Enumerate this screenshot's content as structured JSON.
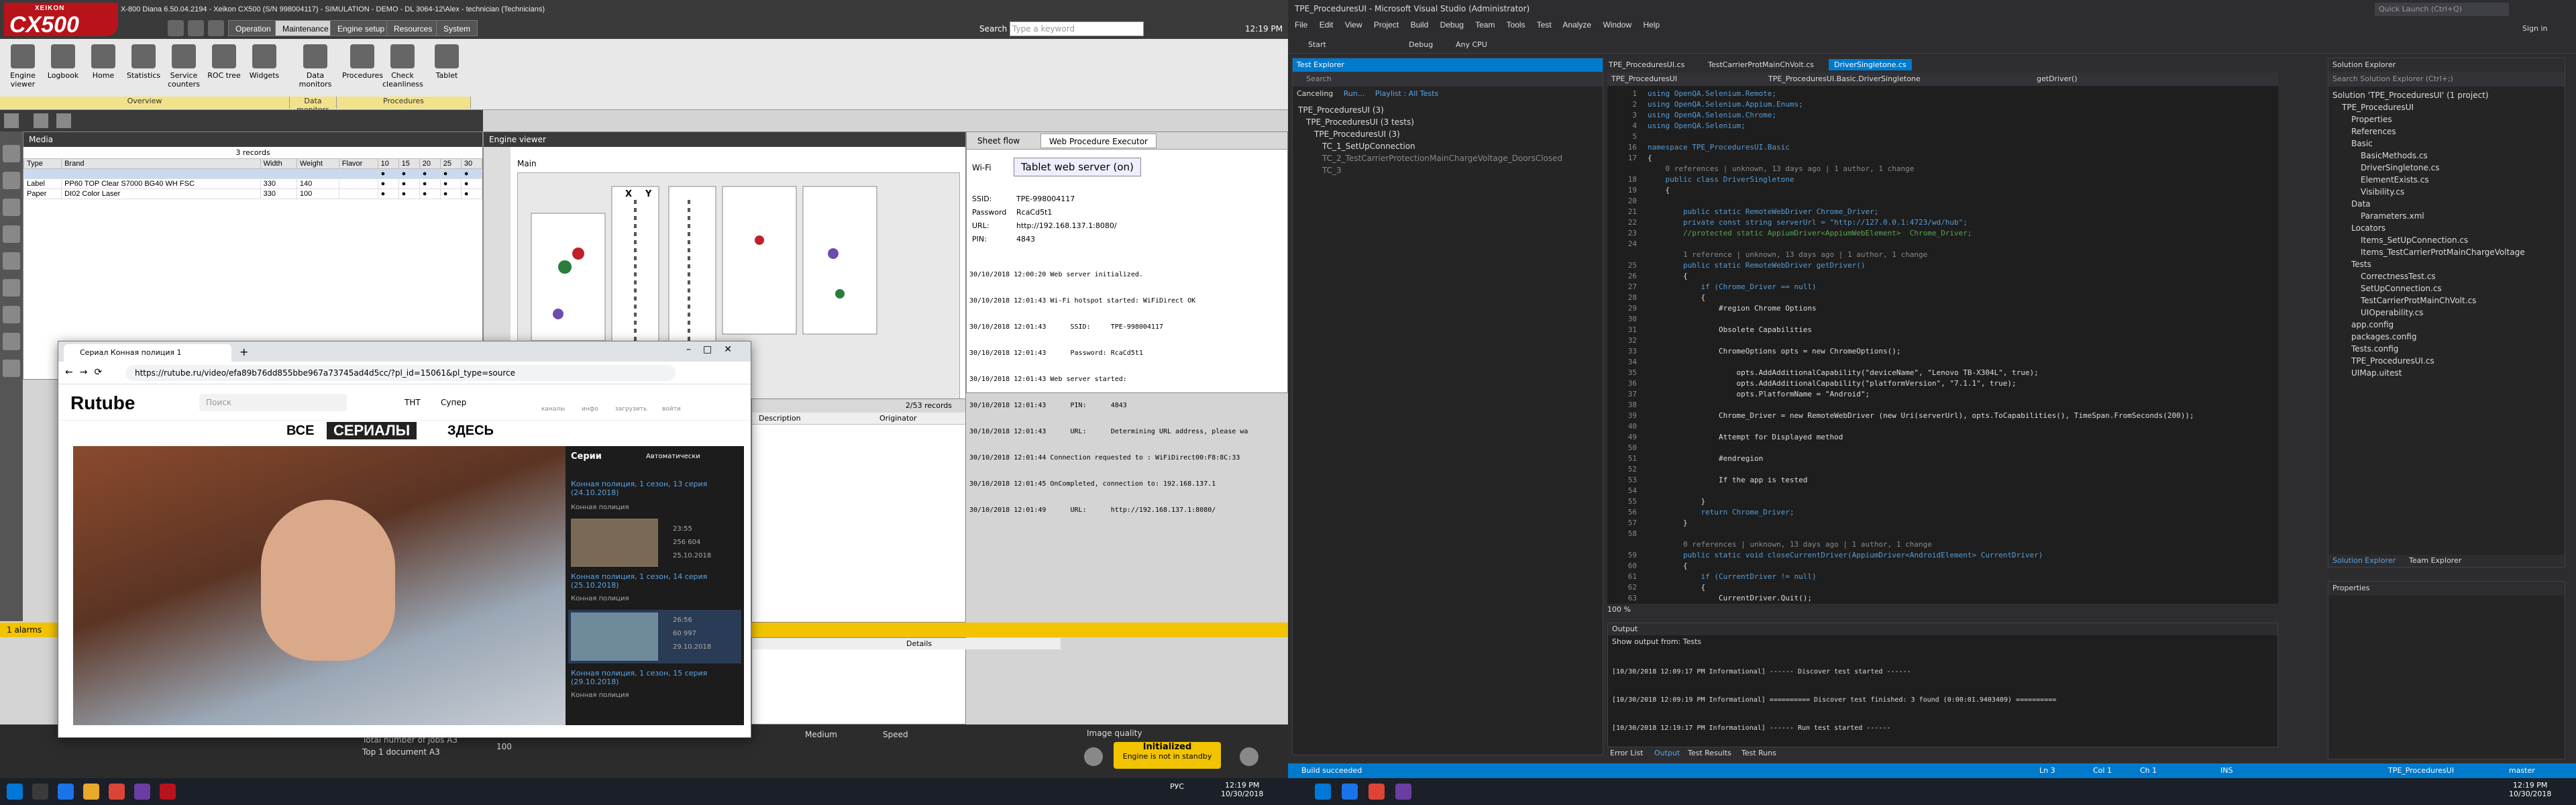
{
  "left_app": {
    "logo_small": "XEIKON",
    "logo_big": "CX500",
    "title": "X-800 Diana 6.50.04.2194 - Xeikon CX500 (S/N 998004117) - SIMULATION - DEMO - DL 3064-12\\Alex - technician (Technicians)",
    "nav_tabs": [
      "Operation",
      "Maintenance",
      "Engine setup",
      "Resources",
      "System"
    ],
    "search_label": "Search",
    "search_placeholder": "Type a keyword",
    "clock": "12:19 PM",
    "ribbon_buttons": [
      "Engine viewer",
      "Logbook",
      "Home",
      "Statistics",
      "Service counters",
      "ROC tree",
      "Widgets",
      "Data monitors",
      "Procedures",
      "Check cleanliness",
      "Tablet"
    ],
    "ribbon_groups": [
      "Overview",
      "Data monitors",
      "Procedures"
    ],
    "media_title": "Media",
    "media_records": "3 records",
    "media_columns": [
      "Type",
      "Brand",
      "Width",
      "Weight",
      "Flavor",
      "10",
      "15",
      "20",
      "25",
      "30"
    ],
    "media_rows": [
      [
        "Label",
        "PP60 TOP Clear S7000 BG40 WH FSC",
        "330",
        "140"
      ],
      [
        "Paper",
        "DI02 Color Laser",
        "330",
        "100"
      ]
    ],
    "engine_viewer_tab": "Engine viewer",
    "engine_main_label": "Main",
    "engine_xy": [
      "X",
      "Y"
    ],
    "sheet_flow_tab": "Sheet flow",
    "webproc_tab": "Web Procedure Executor",
    "wifi_label": "Wi-Fi",
    "wifi_button": "Tablet web server (on)",
    "ssid_label": "SSID:",
    "ssid_value": "TPE-998004117",
    "password_label": "Password",
    "password_value": "RcaCd5t1",
    "url_label": "URL:",
    "url_value": "http://192.168.137.1:8080/",
    "pin_label": "PIN:",
    "pin_value": "4843",
    "log_lines": [
      "30/10/2018 12:00:20 Web server initialized.",
      "30/10/2018 12:01:43 Wi-Fi hotspot started: WiFiDirect OK",
      "30/10/2018 12:01:43      SSID:     TPE-998004117",
      "30/10/2018 12:01:43      Password: RcaCd5t1",
      "30/10/2018 12:01:43 Web server started:",
      "30/10/2018 12:01:43      PIN:      4843",
      "30/10/2018 12:01:43      URL:      Determining URL address, please wa",
      "30/10/2018 12:01:44 Connection requested to : WiFiDirect00:F8:8C:33",
      "30/10/2018 12:01:45 OnCompleted, connection to: 192.168.137.1",
      "30/10/2018 12:01:49      URL:      http://192.168.137.1:8080/"
    ],
    "records_label": "2/53 records",
    "grid_cols": [
      "Description",
      "Originator"
    ],
    "alarm_text": "1 alarms",
    "details_label": "Details",
    "status_total": "Total number of jobs  A3",
    "status_top": "Top 1 document   A3",
    "status_speed": "100",
    "medium_label": "Medium",
    "speed_label": "Speed",
    "image_quality_label": "Image quality",
    "init_title": "Initialized",
    "init_sub": "Engine is not in standby"
  },
  "browser": {
    "tab_title": "Сериал Конная полиция 1",
    "url": "https://rutube.ru/video/efa89b76dd855bbe967a73745ad4d5cc/?pl_id=15061&pl_type=source",
    "brand": "Rutube",
    "search_placeholder": "Поиск",
    "nav_links": [
      "ТНТ",
      "Супер"
    ],
    "header_icons": [
      "каналы",
      "инфо",
      "загрузить",
      "войти"
    ],
    "banner_left": "ВСЕ",
    "banner_mid": "СЕРИАЛЫ",
    "banner_right": "ЗДЕСЬ",
    "sidebar_title": "Серии",
    "autoplay": "Автоматически",
    "episodes": [
      {
        "title": "Конная полиция, 1 сезон, 13 серия (24.10.2018)",
        "channel": "Конная полиция",
        "duration": "",
        "views": "",
        "date": ""
      },
      {
        "title": "Конная полиция, 1 сезон, 14 серия (25.10.2018)",
        "channel": "Конная полиция",
        "duration": "23:55",
        "views": "256 604",
        "date": "25.10.2018"
      },
      {
        "title": "Конная полиция, 1 сезон, 15 серия (29.10.2018)",
        "channel": "Конная полиция",
        "duration": "26:56",
        "views": "60 997",
        "date": "29.10.2018"
      }
    ]
  },
  "vs": {
    "title": "TPE_ProceduresUI - Microsoft Visual Studio (Administrator)",
    "quick_launch": "Quick Launch (Ctrl+Q)",
    "sign_in": "Sign in",
    "menu": [
      "File",
      "Edit",
      "View",
      "Project",
      "Build",
      "Debug",
      "Team",
      "Tools",
      "Test",
      "Analyze",
      "Window",
      "Help"
    ],
    "toolbar": [
      "Start",
      "Debug",
      "Any CPU"
    ],
    "test_explorer_title": "Test Explorer",
    "test_search": "Search",
    "test_bar": [
      "Canceling",
      "Run...",
      "Playlist : All Tests"
    ],
    "tests": [
      "TPE_ProceduresUI (3)",
      "TPE_ProceduresUI (3 tests)",
      "TPE_ProceduresUI (3)",
      "TC_1_SetUpConnection",
      "TC_2_TestCarrierProtectionMainChargeVoltage_DoorsClosed",
      "TC_3"
    ],
    "doc_tabs": [
      "TPE_ProceduresUI.cs",
      "TestCarrierProtMainChVolt.cs",
      "DriverSingletone.cs"
    ],
    "nav_left": "TPE_ProceduresUI",
    "nav_mid": "TPE_ProceduresUI.Basic.DriverSingletone",
    "nav_right": "getDriver()",
    "code_lines": [
      {
        "n": "1",
        "t": "using OpenQA.Selenium.Remote;"
      },
      {
        "n": "2",
        "t": "using OpenQA.Selenium.Appium.Enums;"
      },
      {
        "n": "3",
        "t": "using OpenQA.Selenium.Chrome;"
      },
      {
        "n": "4",
        "t": "using OpenQA.Selenium;"
      },
      {
        "n": "5",
        "t": ""
      },
      {
        "n": "16",
        "t": "namespace TPE_ProceduresUI.Basic"
      },
      {
        "n": "17",
        "t": "{"
      },
      {
        "n": "",
        "t": "    0 references | unknown, 13 days ago | 1 author, 1 change"
      },
      {
        "n": "18",
        "t": "    public class DriverSingletone"
      },
      {
        "n": "19",
        "t": "    {"
      },
      {
        "n": "20",
        "t": ""
      },
      {
        "n": "21",
        "t": "        public static RemoteWebDriver Chrome_Driver;"
      },
      {
        "n": "22",
        "t": "        private const string serverUrl = \"http://127.0.0.1:4723/wd/hub\";"
      },
      {
        "n": "23",
        "t": "        //protected static AppiumDriver<AppiumWebElement>  Chrome_Driver;"
      },
      {
        "n": "24",
        "t": ""
      },
      {
        "n": "",
        "t": "        1 reference | unknown, 13 days ago | 1 author, 1 change"
      },
      {
        "n": "25",
        "t": "        public static RemoteWebDriver getDriver()"
      },
      {
        "n": "26",
        "t": "        {"
      },
      {
        "n": "27",
        "t": "            if (Chrome_Driver == null)"
      },
      {
        "n": "28",
        "t": "            {"
      },
      {
        "n": "29",
        "t": "                #region Chrome Options"
      },
      {
        "n": "30",
        "t": ""
      },
      {
        "n": "31",
        "t": "                Obsolete Capabilities"
      },
      {
        "n": "32",
        "t": ""
      },
      {
        "n": "33",
        "t": "                ChromeOptions opts = new ChromeOptions();"
      },
      {
        "n": "34",
        "t": ""
      },
      {
        "n": "35",
        "t": "                    opts.AddAdditionalCapability(\"deviceName\", \"Lenovo TB-X304L\", true);"
      },
      {
        "n": "36",
        "t": "                    opts.AddAdditionalCapability(\"platformVersion\", \"7.1.1\", true);"
      },
      {
        "n": "37",
        "t": "                    opts.PlatformName = \"Android\";"
      },
      {
        "n": "38",
        "t": ""
      },
      {
        "n": "39",
        "t": "                Chrome_Driver = new RemoteWebDriver (new Uri(serverUrl), opts.ToCapabilities(), TimeSpan.FromSeconds(200));"
      },
      {
        "n": "40",
        "t": ""
      },
      {
        "n": "49",
        "t": "                Attempt for Displayed method"
      },
      {
        "n": "50",
        "t": ""
      },
      {
        "n": "51",
        "t": "                #endregion"
      },
      {
        "n": "52",
        "t": ""
      },
      {
        "n": "53",
        "t": "                If the app is tested"
      },
      {
        "n": "54",
        "t": ""
      },
      {
        "n": "55",
        "t": "            }"
      },
      {
        "n": "56",
        "t": "            return Chrome_Driver;"
      },
      {
        "n": "57",
        "t": "        }"
      },
      {
        "n": "58",
        "t": ""
      },
      {
        "n": "",
        "t": "        0 references | unknown, 13 days ago | 1 author, 1 change"
      },
      {
        "n": "59",
        "t": "        public static void closeCurrentDriver(AppiumDriver<AndroidElement> CurrentDriver)"
      },
      {
        "n": "60",
        "t": "        {"
      },
      {
        "n": "61",
        "t": "            if (CurrentDriver != null)"
      },
      {
        "n": "62",
        "t": "            {"
      },
      {
        "n": "63",
        "t": "                CurrentDriver.Quit();"
      },
      {
        "n": "64",
        "t": "                CurrentDriver = null;"
      },
      {
        "n": "65",
        "t": "            }"
      }
    ],
    "zoom": "100 %",
    "output_title": "Output",
    "output_from": "Show output from:  Tests",
    "output_lines": [
      "[10/30/2018 12:09:17 PM Informational] ------ Discover test started ------",
      "[10/30/2018 12:09:19 PM Informational] ========== Discover test finished: 3 found (0:00:01.9403409) ==========",
      "[10/30/2018 12:19:17 PM Informational] ------ Run test started ------"
    ],
    "bottom_tabs": [
      "Error List",
      "Output",
      "Test Results",
      "Test Runs"
    ],
    "se_title": "Solution Explorer",
    "se_search": "Search Solution Explorer (Ctrl+;)",
    "se_items": [
      "Solution 'TPE_ProceduresUI' (1 project)",
      "TPE_ProceduresUI",
      "Properties",
      "References",
      "Basic",
      "BasicMethods.cs",
      "DriverSingletone.cs",
      "ElementExists.cs",
      "Visibility.cs",
      "Data",
      "Parameters.xml",
      "Locators",
      "Items_SetUpConnection.cs",
      "Items_TestCarrierProtMainChargeVoltage",
      "Tests",
      "CorrectnessTest.cs",
      "SetUpConnection.cs",
      "TestCarrierProtMainChVolt.cs",
      "UIOperability.cs",
      "app.config",
      "packages.config",
      "Tests.config",
      "TPE_ProceduresUI.cs",
      "UIMap.uitest"
    ],
    "se_tabs": [
      "Solution Explorer",
      "Team Explorer"
    ],
    "props_title": "Properties",
    "status_msg": "Build succeeded",
    "status_ln": "Ln 3",
    "status_col": "Col 1",
    "status_ch": "Ch 1",
    "status_ins": "INS",
    "status_proj": "TPE_ProceduresUI",
    "status_branch": "master"
  },
  "taskbar": {
    "clock_left": "12:19 PM",
    "date_left": "10/30/2018",
    "clock_right": "12:19 PM",
    "date_right": "10/30/2018",
    "lang": "РУС"
  }
}
